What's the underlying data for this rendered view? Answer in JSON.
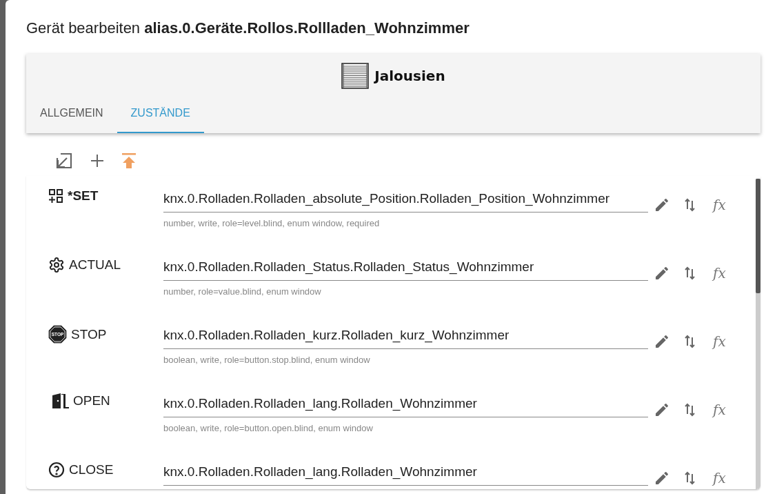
{
  "dialog": {
    "title_prefix": "Gerät bearbeiten",
    "title_id": "alias.0.Geräte.Rollos.Rollladen_Wohnzimmer"
  },
  "device": {
    "type_label": "Jalousien"
  },
  "tabs": [
    {
      "label": "ALLGEMEIN",
      "selected": false
    },
    {
      "label": "ZUSTÄNDE",
      "selected": true
    }
  ],
  "states": [
    {
      "kind": "set",
      "name": "*SET",
      "required": true,
      "value": "knx.0.Rolladen.Rolladen_absolute_Position.Rolladen_Position_Wohnzimmer",
      "hint": "number, write, role=level.blind, enum window, required",
      "function_label": "fx"
    },
    {
      "kind": "actual",
      "name": "ACTUAL",
      "required": false,
      "value": "knx.0.Rolladen.Rolladen_Status.Rolladen_Status_Wohnzimmer",
      "hint": "number, role=value.blind, enum window",
      "function_label": "fx"
    },
    {
      "kind": "stop",
      "name": "STOP",
      "required": false,
      "icon_text": "STOP",
      "value": "knx.0.Rolladen.Rolladen_kurz.Rolladen_kurz_Wohnzimmer",
      "hint": "boolean, write, role=button.stop.blind, enum window",
      "function_label": "fx"
    },
    {
      "kind": "open",
      "name": "OPEN",
      "required": false,
      "value": "knx.0.Rolladen.Rolladen_lang.Rolladen_Wohnzimmer",
      "hint": "boolean, write, role=button.open.blind, enum window",
      "function_label": "fx"
    },
    {
      "kind": "close",
      "name": "CLOSE",
      "required": false,
      "value": "knx.0.Rolladen.Rolladen_lang.Rolladen_Wohnzimmer",
      "function_label": "fx"
    }
  ]
}
